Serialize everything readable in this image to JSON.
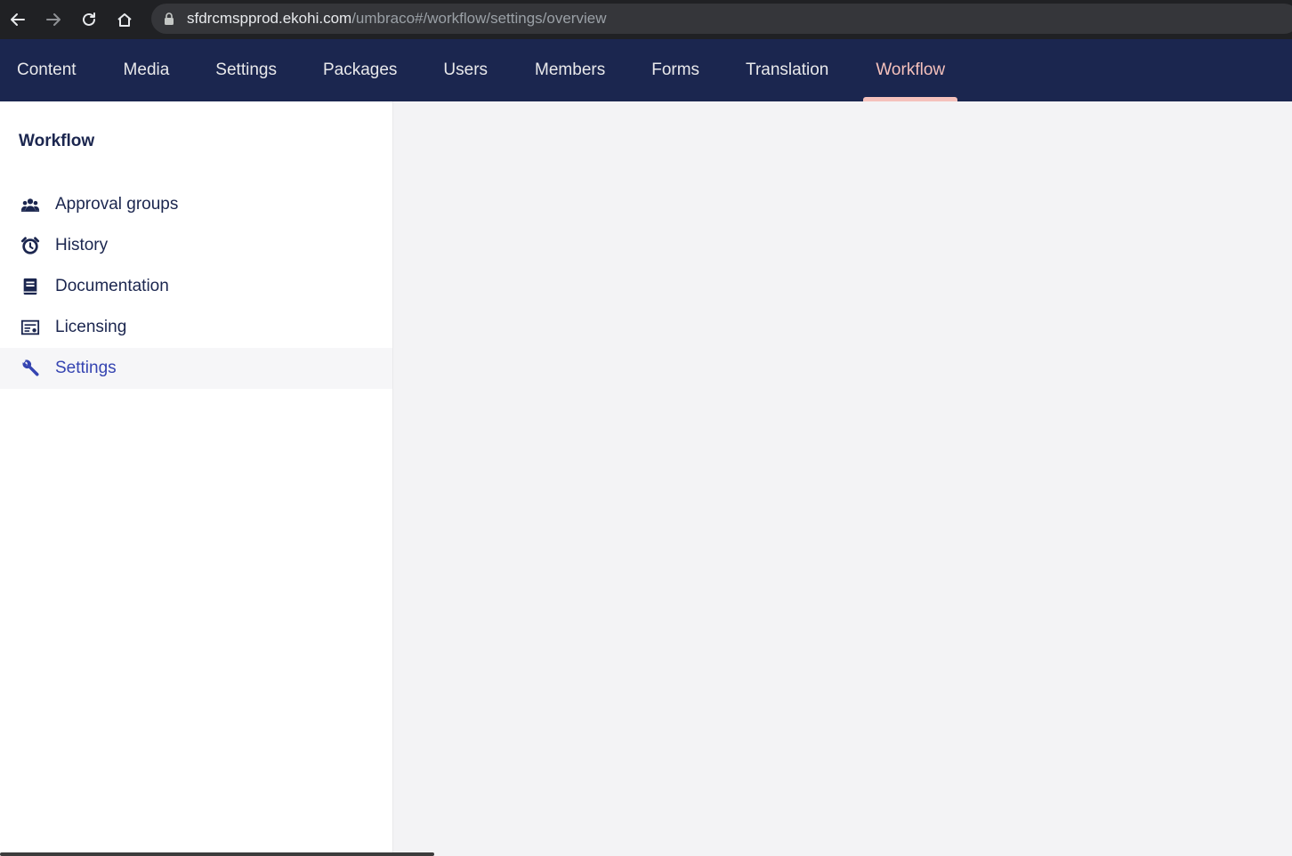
{
  "browser": {
    "url_host": "sfdrcmspprod.ekohi.com",
    "url_path": "/umbraco#/workflow/settings/overview"
  },
  "sections": [
    {
      "label": "Content",
      "active": false
    },
    {
      "label": "Media",
      "active": false
    },
    {
      "label": "Settings",
      "active": false
    },
    {
      "label": "Packages",
      "active": false
    },
    {
      "label": "Users",
      "active": false
    },
    {
      "label": "Members",
      "active": false
    },
    {
      "label": "Forms",
      "active": false
    },
    {
      "label": "Translation",
      "active": false
    },
    {
      "label": "Workflow",
      "active": true
    }
  ],
  "sidebar": {
    "title": "Workflow",
    "items": [
      {
        "label": "Approval groups",
        "icon": "users-icon",
        "active": false
      },
      {
        "label": "History",
        "icon": "alarm-clock-icon",
        "active": false
      },
      {
        "label": "Documentation",
        "icon": "book-icon",
        "active": false
      },
      {
        "label": "Licensing",
        "icon": "certificate-icon",
        "active": false
      },
      {
        "label": "Settings",
        "icon": "wrench-icon",
        "active": true
      }
    ]
  },
  "colors": {
    "nav_bg": "#1b264f",
    "active_tab": "#f5c1bc",
    "active_tree_text": "#3544b1"
  }
}
